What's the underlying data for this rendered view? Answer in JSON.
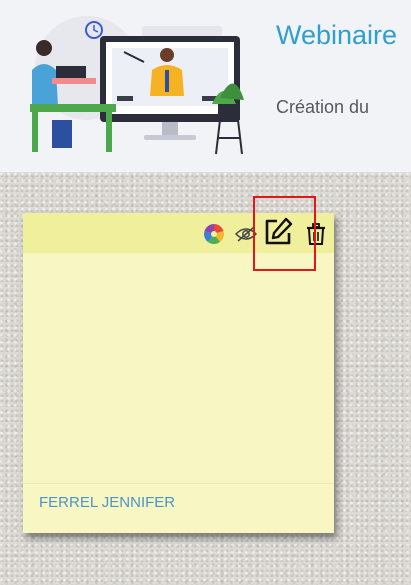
{
  "header": {
    "title": "Webinaire",
    "subtitle": "Création du"
  },
  "note": {
    "author": "FERREL JENNIFER",
    "tools": {
      "color": "palette-icon",
      "view": "eye-icon",
      "edit": "edit-icon",
      "delete": "trash-icon"
    }
  },
  "colors": {
    "title": "#2e9fd0",
    "note_background": "#f8f7c3",
    "note_header": "#f0ef9c",
    "author": "#4a95c9",
    "highlight": "#e4161b"
  }
}
